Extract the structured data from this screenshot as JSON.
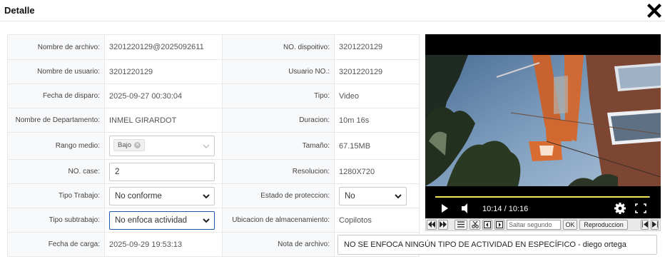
{
  "dialog": {
    "title": "Detalle"
  },
  "form": {
    "nombre_archivo": {
      "label": "Nombre de archivo:",
      "value": "3201220129@2025092611"
    },
    "no_dispositivo": {
      "label": "NO. dispoitivo:",
      "value": "3201220129"
    },
    "nombre_usuario": {
      "label": "Nombre de usuario:",
      "value": "3201220129"
    },
    "usuario_no": {
      "label": "Usuario NO.:",
      "value": "3201220129"
    },
    "fecha_disparo": {
      "label": "Fecha de disparo:",
      "value": "2025-09-27 00:30:04"
    },
    "tipo": {
      "label": "Tipo:",
      "value": "Video"
    },
    "departamento": {
      "label": "Nombre de Departamento:",
      "value": "INMEL GIRARDOT"
    },
    "duracion": {
      "label": "Duracion:",
      "value": "10m 16s"
    },
    "rango_medio": {
      "label": "Rango medio:",
      "chip": "Bajo"
    },
    "tamano": {
      "label": "Tamaño:",
      "value": "67.15MB"
    },
    "no_case": {
      "label": "NO. case:",
      "value": "2"
    },
    "resolucion": {
      "label": "Resolucion:",
      "value": "1280X720"
    },
    "tipo_trabajo": {
      "label": "Tipo Trabajo:",
      "value": "No conforme"
    },
    "estado_proteccion": {
      "label": "Estado de proteccion:",
      "value": "No"
    },
    "tipo_subtrabajo": {
      "label": "Tipo subtrabajo:",
      "value": "No enfoca actividad"
    },
    "ubicacion": {
      "label": "Ubicacion de almacenamiento:",
      "value": "Copilotos"
    },
    "fecha_carga": {
      "label": "Fecha de carga:",
      "value": "2025-09-29 19:53:13"
    },
    "nota_archivo": {
      "label": "Nota de archivo:",
      "value": "NO SE ENFOCA NINGÚN TIPO DE ACTIVIDAD EN ESPECÍFICO - diego ortega"
    }
  },
  "player": {
    "time": "10:14 / 10:16",
    "progress": 0.997,
    "seek_placeholder": "Saltar segundo",
    "ok_label": "OK",
    "playback_label": "Reproduccion"
  }
}
